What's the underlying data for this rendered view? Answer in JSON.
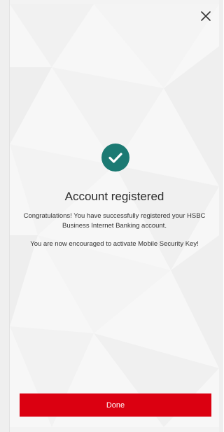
{
  "dialog": {
    "title": "Account registered",
    "message_congrats": "Congratulations! You have successfully registered your HSBC Business Internet Banking account.",
    "message_encourage": "You are now encouraged to activate Mobile Security Key!",
    "done_label": "Done",
    "close_icon": "close-icon",
    "success_icon": "checkmark-icon"
  },
  "colors": {
    "accent_red": "#db0011",
    "success_teal": "#1c7a73",
    "background": "#f7f7f7"
  }
}
